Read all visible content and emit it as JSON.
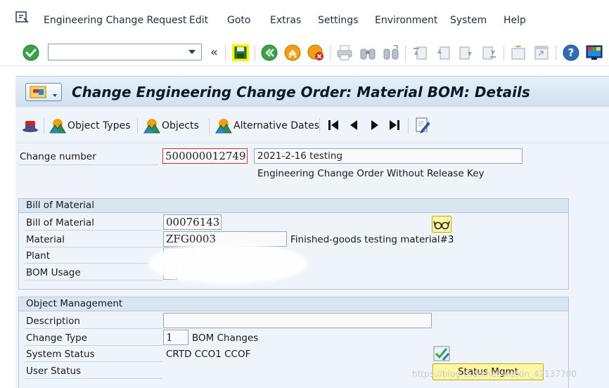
{
  "menu": [
    "Engineering Change Request",
    "Edit",
    "Goto",
    "Extras",
    "Settings",
    "Environment",
    "System",
    "Help"
  ],
  "toolbar": {
    "command_value": "",
    "nav_back_glyph": "«"
  },
  "title": "Change Engineering Change Order: Material BOM: Details",
  "app_toolbar": {
    "object_types": "Object Types",
    "objects": "Objects",
    "alternative_dates": "Alternative Dates"
  },
  "header": {
    "change_number_label": "Change number",
    "change_number": "500000012749",
    "change_description": "2021-2-16 testing",
    "change_type_text": "Engineering Change Order Without Release Key"
  },
  "bom": {
    "group_title": "Bill of Material",
    "bom_label": "Bill of Material",
    "bom_value": "00076143",
    "material_label": "Material",
    "material_value": "ZFG0003",
    "material_desc": "Finished-goods testing material#3",
    "plant_label": "Plant",
    "usage_label": "BOM Usage"
  },
  "object_mgmt": {
    "group_title": "Object Management",
    "description_label": "Description",
    "description_value": "",
    "change_type_label": "Change Type",
    "change_type_value": "1",
    "change_type_desc": "BOM Changes",
    "system_status_label": "System Status",
    "system_status_value": "CRTD CCO1 CCOF",
    "user_status_label": "User Status",
    "status_button": "Status Mgmt"
  },
  "watermark": "https://blog.csdn.net/weixin_42137700",
  "colors": {
    "accent_green": "#3aa34a",
    "accent_orange": "#f2a012",
    "title_bg": "#d9e7f3",
    "button_yellow": "#fff6a8"
  }
}
